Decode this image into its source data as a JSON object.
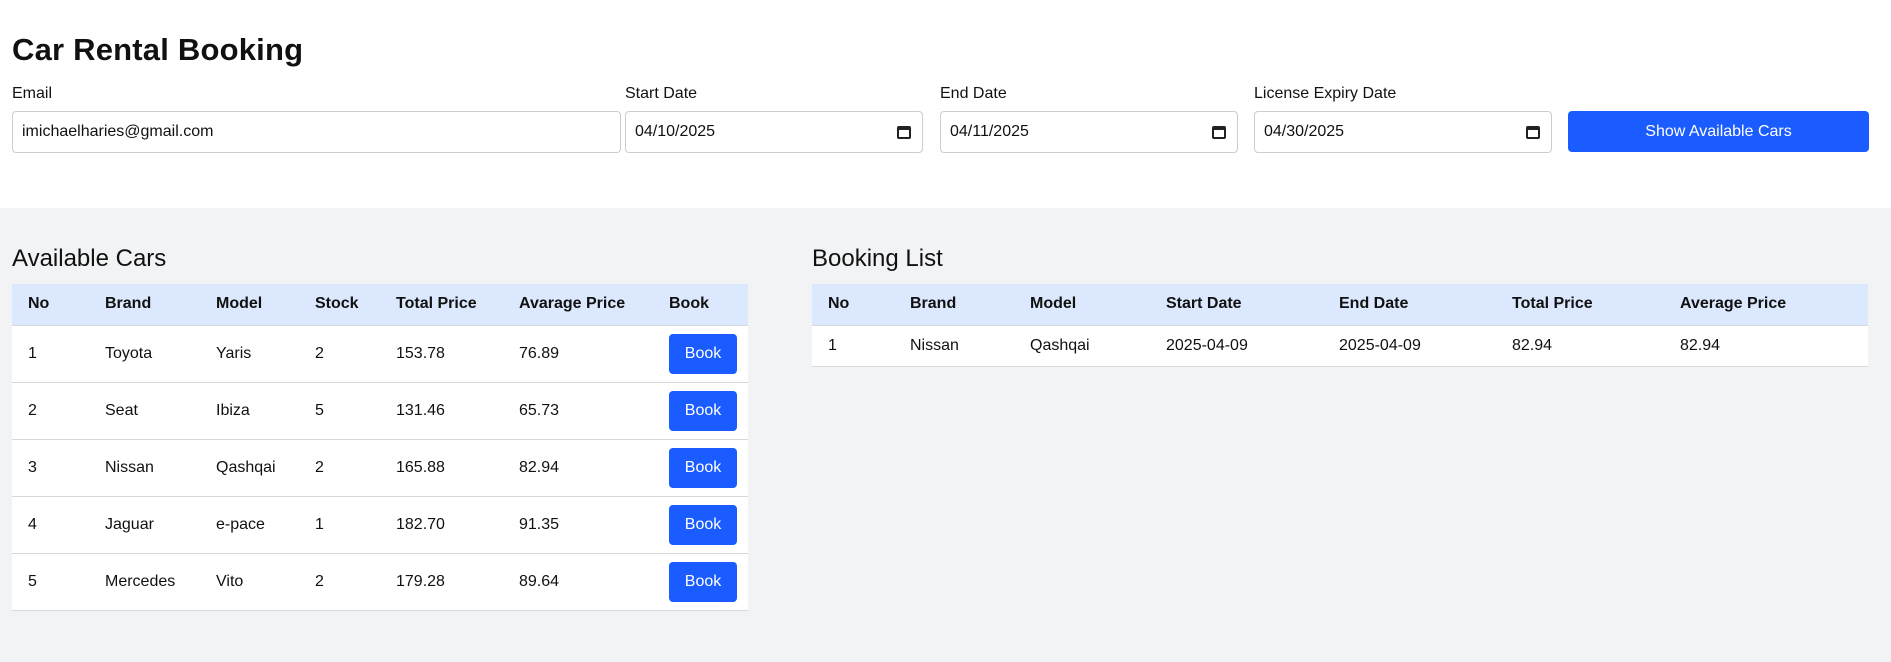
{
  "page_title": "Car Rental Booking",
  "form": {
    "email_label": "Email",
    "email_value": "imichaelharies@gmail.com",
    "start_label": "Start Date",
    "start_value": "04/10/2025",
    "end_label": "End Date",
    "end_value": "04/11/2025",
    "license_label": "License Expiry Date",
    "license_value": "04/30/2025",
    "submit_label": "Show Available Cars"
  },
  "available": {
    "title": "Available Cars",
    "headers": [
      "No",
      "Brand",
      "Model",
      "Stock",
      "Total Price",
      "Avarage Price",
      "Book"
    ],
    "button_label": "Book",
    "rows": [
      [
        "1",
        "Toyota",
        "Yaris",
        "2",
        "153.78",
        "76.89"
      ],
      [
        "2",
        "Seat",
        "Ibiza",
        "5",
        "131.46",
        "65.73"
      ],
      [
        "3",
        "Nissan",
        "Qashqai",
        "2",
        "165.88",
        "82.94"
      ],
      [
        "4",
        "Jaguar",
        "e-pace",
        "1",
        "182.70",
        "91.35"
      ],
      [
        "5",
        "Mercedes",
        "Vito",
        "2",
        "179.28",
        "89.64"
      ]
    ]
  },
  "bookings": {
    "title": "Booking List",
    "headers": [
      "No",
      "Brand",
      "Model",
      "Start Date",
      "End Date",
      "Total Price",
      "Average Price"
    ],
    "rows": [
      [
        "1",
        "Nissan",
        "Qashqai",
        "2025-04-09",
        "2025-04-09",
        "82.94",
        "82.94"
      ]
    ]
  }
}
